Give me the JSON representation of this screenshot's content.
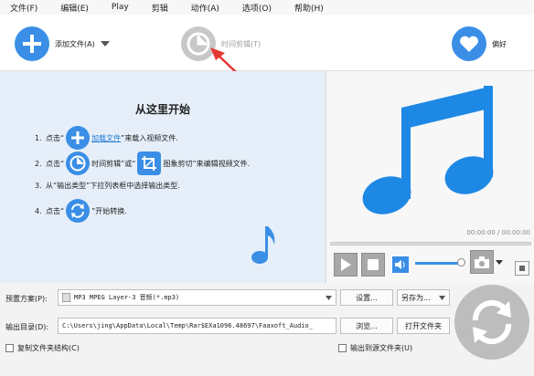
{
  "menu": [
    "文件(F)",
    "编辑(E)",
    "Play",
    "剪辑",
    "动作(A)",
    "选项(O)",
    "帮助(H)"
  ],
  "toolbar": {
    "add_file": "添加文件(A)",
    "trim": "时间剪辑(T)",
    "favorites": "偏好"
  },
  "guide": {
    "title": "从这里开始",
    "step1": {
      "num": "1.",
      "pre": "点击“",
      "link": "加载文件",
      "post": "”来载入视频文件."
    },
    "step2": {
      "num": "2.",
      "pre": "点击“",
      "a": "时间剪辑",
      "mid": "”或“",
      "b": "图象剪切",
      "post": "”来编辑视频文件."
    },
    "step3": {
      "num": "3.",
      "text": "从“输出类型”下拉列表框中选择输出类型."
    },
    "step4": {
      "num": "4.",
      "pre": "点击“",
      "post": "”开始转换."
    }
  },
  "player": {
    "time_top": "00:00:00 / 00:00:00",
    "time_bottom": "00:00:00 / 00:00:00",
    "volume_level": 0.9
  },
  "preset": {
    "label": "预置方案(P):",
    "value": "MP3 MPEG Layer-3 音频(*.mp3)",
    "settings": "设置...",
    "save_as": "另存为..."
  },
  "output": {
    "label": "输出目录(D):",
    "value": "C:\\Users\\jing\\AppData\\Local\\Temp\\Rar$EXa1096.48697\\Faaxoft_Audio_",
    "browse": "浏览...",
    "open_folder": "打开文件夹"
  },
  "options": {
    "copy_structure": "复制文件夹结构(C)",
    "output_to_source": "输出到源文件夹(U)"
  },
  "colors": {
    "accent": "#3a8ee6",
    "panel": "#e6eff9",
    "arrow": "#e53935"
  }
}
